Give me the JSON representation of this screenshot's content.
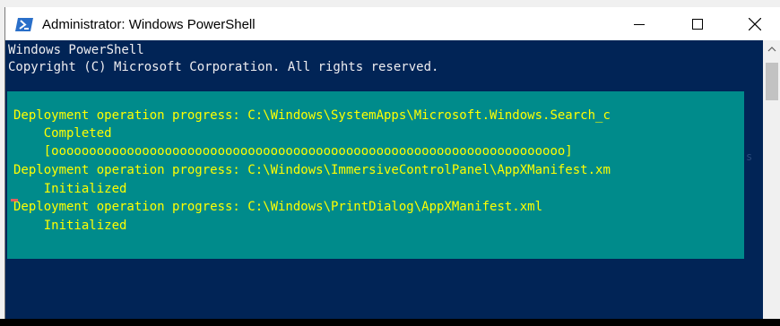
{
  "window": {
    "title": "Administrator: Windows PowerShell",
    "icon": "powershell-icon",
    "controls": {
      "minimize": "minimize-icon",
      "maximize": "maximize-icon",
      "close": "close-icon"
    }
  },
  "console": {
    "header": [
      "Windows PowerShell",
      "Copyright (C) Microsoft Corporation. All rights reserved."
    ],
    "progress": [
      "Deployment operation progress: C:\\Windows\\SystemApps\\Microsoft.Windows.Search_c",
      "    Completed",
      "    [oooooooooooooooooooooooooooooooooooooooooooooooooooooooooooooooooooo]",
      "Deployment operation progress: C:\\Windows\\ImmersiveControlPanel\\AppXManifest.xm",
      "    Initialized",
      "Deployment operation progress: C:\\Windows\\PrintDialog\\AppXManifest.xml",
      "    Initialized"
    ],
    "ghost_text": "s"
  },
  "colors": {
    "console_bg": "#012456",
    "progress_bg": "#008b8b",
    "progress_text": "#ffff00",
    "header_text": "#eeedf0"
  },
  "scrollbar": {
    "up_icon": "chevron-up-icon"
  }
}
